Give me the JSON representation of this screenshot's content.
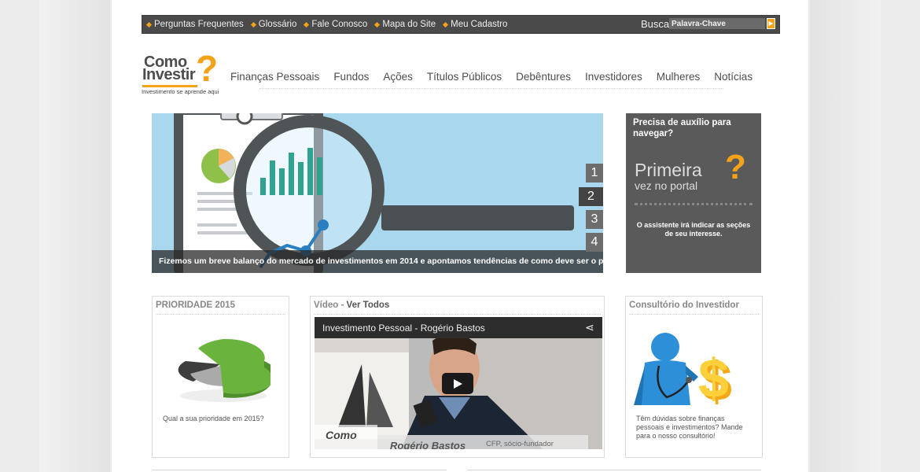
{
  "topbar": {
    "links": [
      "Perguntas Frequentes",
      "Glossário",
      "Fale Conosco",
      "Mapa do Site",
      "Meu Cadastro"
    ],
    "search_label": "Busca",
    "search_placeholder": "Palavra-Chave"
  },
  "logo": {
    "line1": "Como",
    "line2": "Investir",
    "mark": "?",
    "tagline": "Investimento se aprende aqui"
  },
  "nav": [
    "Finanças Pessoais",
    "Fundos",
    "Ações",
    "Títulos Públicos",
    "Debêntures",
    "Investidores",
    "Mulheres",
    "Notícias"
  ],
  "hero": {
    "caption": "Fizemos um breve balanço do mercado de investimentos em 2014 e apontamos tendências de como deve ser o próximo ano.",
    "pages": [
      "1",
      "2",
      "3",
      "4"
    ],
    "active_page": "2"
  },
  "help": {
    "title": "Precisa de auxílio para navegar?",
    "primeira": "Primeira",
    "vez": "vez no portal",
    "desc": "O assistente irá indicar as seções de seu interesse."
  },
  "cards": {
    "prioridade": {
      "title": "PRIORIDADE 2015",
      "text": "Qual a sua prioridade em 2015?"
    },
    "video": {
      "title": "Vídeo",
      "sep": " - ",
      "link": "Ver Todos",
      "video_title": "Investimento Pessoal - Rogério Bastos",
      "lower_name": "Rogério Bastos",
      "lower_role": "CFP, sócio-fundador"
    },
    "consultorio": {
      "title": "Consultório do Investidor",
      "text": "Têm dúvidas sobre finanças pessoais e investimentos? Mande para o nosso consultório!"
    }
  },
  "colors": {
    "accent": "#f3a31a",
    "topbar": "#4a4a4a",
    "hero_bg": "#a8d7ee",
    "help_bg": "#5a5a5a"
  }
}
